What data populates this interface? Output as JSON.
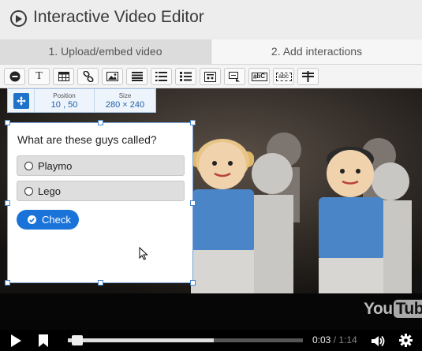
{
  "app": {
    "title": "Interactive Video Editor",
    "icon": "play-circle-icon"
  },
  "tabs": [
    {
      "label": "1. Upload/embed video",
      "active": false
    },
    {
      "label": "2. Add interactions",
      "active": true
    }
  ],
  "toolbar": {
    "buttons": [
      {
        "name": "label",
        "icon": "label-icon"
      },
      {
        "name": "text",
        "icon": "text-icon",
        "glyph": "T"
      },
      {
        "name": "table",
        "icon": "table-icon"
      },
      {
        "name": "link",
        "icon": "link-icon"
      },
      {
        "name": "image",
        "icon": "image-icon"
      },
      {
        "name": "statements",
        "icon": "statements-icon"
      },
      {
        "name": "single-choice",
        "icon": "single-choice-icon"
      },
      {
        "name": "multiple-choice",
        "icon": "multiple-choice-icon"
      },
      {
        "name": "true-false",
        "icon": "true-false-icon"
      },
      {
        "name": "fill-in-blanks",
        "icon": "fill-blanks-icon"
      },
      {
        "name": "drag-text",
        "icon": "drag-text-icon",
        "glyph": "a̲bC"
      },
      {
        "name": "mark-words",
        "icon": "mark-words-icon",
        "glyph": "abc"
      },
      {
        "name": "crossroads",
        "icon": "crossroads-icon"
      }
    ]
  },
  "position_panel": {
    "position_label": "Position",
    "position_value": "10 , 50",
    "size_label": "Size",
    "size_value": "280 × 240"
  },
  "interaction": {
    "question": "What are these guys called?",
    "options": [
      "Playmo",
      "Lego"
    ],
    "check_label": "Check"
  },
  "video": {
    "watermark": "You",
    "watermark_tube": "Tube"
  },
  "player": {
    "current_time": "0:03",
    "separator": " / ",
    "duration": "1:14",
    "progress": 0.04,
    "buffered": 0.62
  },
  "colors": {
    "accent": "#1a73d9",
    "header_bg": "#ededed",
    "video_bg": "#060606"
  }
}
